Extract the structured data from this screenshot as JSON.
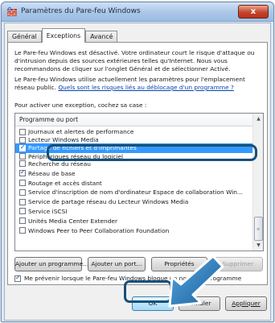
{
  "window": {
    "title": "Paramètres du Pare-feu Windows",
    "close_label": "x"
  },
  "tabs": [
    {
      "label": "Général",
      "active": false
    },
    {
      "label": "Exceptions",
      "active": true
    },
    {
      "label": "Avancé",
      "active": false
    }
  ],
  "exceptions": {
    "description1": "Le Pare-feu Windows est désactivé. Votre ordinateur court le risque d'attaque ou d'intrusion depuis des sources extérieures telles qu'Internet. Nous vous recommandons de cliquer sur l'onglet Général et de sélectionner Activé.",
    "description2": "Le Pare-feu Windows utilise actuellement les paramètres pour l'emplacement réseau public.",
    "link": "Quels sont les risques liés au déblocage d'un programme ?",
    "prompt": "Pour activer une exception, cochez sa case :",
    "list_header": "Programme ou port",
    "items": [
      {
        "label": "Journaux et alertes de performance",
        "checked": false
      },
      {
        "label": "Lecteur Windows Media",
        "checked": false
      },
      {
        "label": "Partage de fichiers et d'imprimantes",
        "checked": true
      },
      {
        "label": "Périphériques réseau du logiciel",
        "checked": false
      },
      {
        "label": "Recherche du réseau",
        "checked": false
      },
      {
        "label": "Réseau de base",
        "checked": true
      },
      {
        "label": "Routage et accès distant",
        "checked": false
      },
      {
        "label": "Service d'inscription de nom d'ordinateur Espace de collaboration Win...",
        "checked": false
      },
      {
        "label": "Service de partage réseau du Lecteur Windows Media",
        "checked": false
      },
      {
        "label": "Service iSCSI",
        "checked": false
      },
      {
        "label": "Unités Media Center Extender",
        "checked": false
      },
      {
        "label": "Windows Peer to Peer Collaboration Foundation",
        "checked": false
      }
    ],
    "selected_index": 2
  },
  "buttons": {
    "add_program": "Ajouter un programme...",
    "add_port": "Ajouter un port...",
    "properties": "Propriétés",
    "delete": "Supprimer",
    "ok": "OK",
    "cancel": "Annuler",
    "apply": "Appliquer"
  },
  "notify": {
    "label": "Me prévenir lorsque le Pare-feu Windows bloque un nouveau programme",
    "checked": true
  },
  "colors": {
    "selection": "#3399ff",
    "annotation": "#17507a",
    "arrow": "#1f7ac0"
  }
}
